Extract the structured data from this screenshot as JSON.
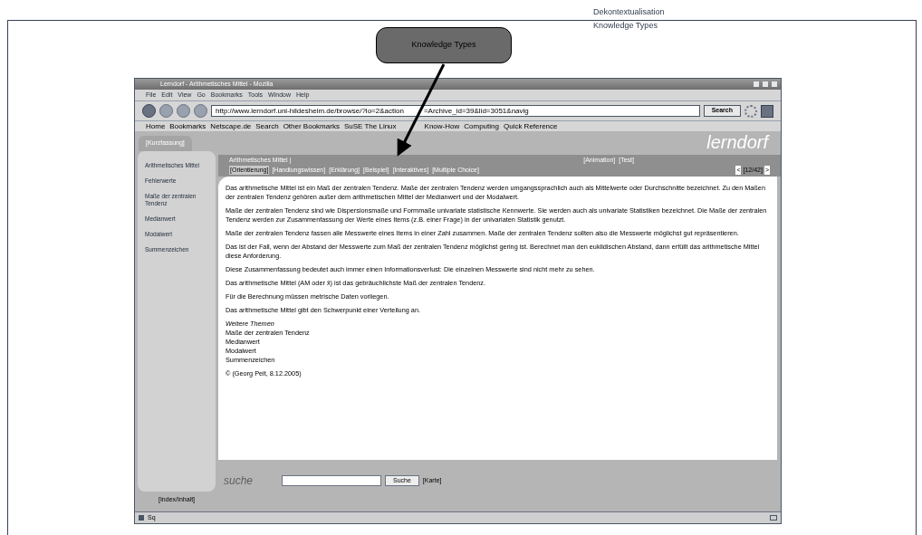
{
  "figure_label": [
    "Dekontextualisation",
    "Knowledge Types"
  ],
  "callout": {
    "text": "Knowledge Types"
  },
  "browser": {
    "title": "Lerndorf - Arithmetisches Mittel - Mozilla",
    "menu": [
      "File",
      "Edit",
      "View",
      "Go",
      "Bookmarks",
      "Tools",
      "Window",
      "Help"
    ],
    "url": [
      "http://www.lerndorf.uni-hildesheim.de/browse/?lo=2&action",
      "=Archive_id=39&lid=3051&navig"
    ],
    "search_button": "Search",
    "bookmarks": [
      "Home",
      "Bookmarks",
      "Netscape.de",
      "Search",
      "Other Bookmarks",
      "SuSE The Linux",
      "Know-How",
      "Computing",
      "Quick Reference"
    ],
    "status_bar": {
      "left": "Sq"
    }
  },
  "page": {
    "logo": "lerndorf",
    "sidebar_tab": "[Kurzfassung]",
    "sidebar_items": [
      {
        "label": "Arithmetisches Mittel"
      },
      {
        "label": "Fehlerwerte"
      },
      {
        "label": "Maße der zentralen Tendenz"
      },
      {
        "label": "Medianwert"
      },
      {
        "label": "Modalwert"
      },
      {
        "label": "Summenzeichen"
      }
    ],
    "topic": "Arithmetisches Mittel |",
    "top_links": [
      "[Animation]",
      "[Test]"
    ],
    "nav_links": [
      {
        "label": "[Orientierung]",
        "selected": true
      },
      {
        "label": "[Handlungswissen]",
        "selected": false
      },
      {
        "label": "[Erklärung]",
        "selected": false
      },
      {
        "label": "[Beispiel]",
        "selected": false
      },
      {
        "label": "[Interaktives]",
        "selected": false
      },
      {
        "label": "[Multiple Choice]",
        "selected": false
      }
    ],
    "pager": {
      "prev": "<",
      "count": "[12/42]",
      "next": ">"
    },
    "paragraphs": [
      "Das arithmetische Mittel ist ein Maß der zentralen Tendenz. Maße der zentralen Tendenz werden umgangssprachlich auch als Mittelwerte oder Durchschnitte bezeichnet. Zu den Maßen der zentralen Tendenz gehören außer dem arithmetischen Mittel der Medianwert und der Modalwert.",
      "Maße der zentralen Tendenz sind wie Dispersionsmaße und Formmaße univariate statistische Kennwerte. Sie werden auch als univariate Statistiken bezeichnet. Die Maße der zentralen Tendenz werden zur Zusammenfassung der Werte eines Items (z.B. einer Frage) in der univariaten Statistik genutzt.",
      "Maße der zentralen Tendenz fassen alle Messwerte eines Items in einer Zahl zusammen. Maße der zentralen Tendenz sollten also die Messwerte möglichst gut repräsentieren.",
      "Das ist der Fall, wenn der Abstand der Messwerte zum Maß der zentralen Tendenz möglichst gering ist. Berechnet man den euklidischen Abstand, dann erfüllt das arithmetische Mittel diese Anforderung.",
      "Diese Zusammenfassung bedeutet auch immer einen Informationsverlust: Die einzelnen Messwerte sind nicht mehr zu sehen.",
      "Das arithmetische Mittel (AM oder x̄) ist das gebräuchlichste Maß der zentralen Tendenz.",
      "Für die Berechnung müssen metrische Daten vorliegen.",
      "Das arithmetische Mittel gibt den Schwerpunkt einer Verteilung an."
    ],
    "more_heading": "Weitere Themen",
    "more_links": [
      "Maße der zentralen Tendenz",
      "Medianwert",
      "Modalwert",
      "Summenzeichen"
    ],
    "copyright": "© (Georg Peit, 8.12.2005)",
    "index_link": "[Index/Inhalt]",
    "search_logo": "suche",
    "search_button": "Suche",
    "map_link": "[Karte]"
  }
}
